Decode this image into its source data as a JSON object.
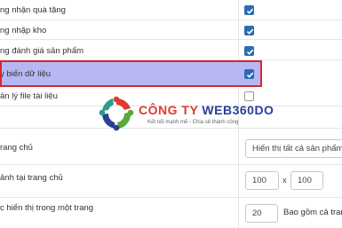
{
  "settings": {
    "checkbox_rows": [
      {
        "label": "ng nhận quà tặng",
        "checked": true
      },
      {
        "label": "ng nhập kho",
        "checked": true
      },
      {
        "label": "ng đánh giá sản phẩm",
        "checked": true
      },
      {
        "label": "y biến dữ liệu",
        "checked": true,
        "highlighted": true
      },
      {
        "label": "ản lý file tài liệu",
        "checked": false
      }
    ],
    "home_display": {
      "label": "rang chủ",
      "value": "Hiển thị tất cả sản phẩm l"
    },
    "image_size": {
      "label": "ảnh tại trang chủ",
      "width": "100",
      "times": "x",
      "height": "100"
    },
    "per_page": {
      "label": "c hiển thị trong một trang",
      "value": "20",
      "suffix": "Bao gồm cả trang"
    }
  },
  "watermark": {
    "brand_prefix": "CÔNG TY ",
    "brand_suffix": "WEB360DO",
    "slogan": "Kết nối mạnh mẽ - Chia sẻ thành công"
  },
  "colors": {
    "checkbox_checked": "#2b6cb0",
    "highlight_fill": "#b7b7f3",
    "highlight_border": "#d9262c",
    "brand_red": "#e03a2e",
    "brand_blue": "#2a3f98",
    "brand_green": "#5aa83c"
  }
}
